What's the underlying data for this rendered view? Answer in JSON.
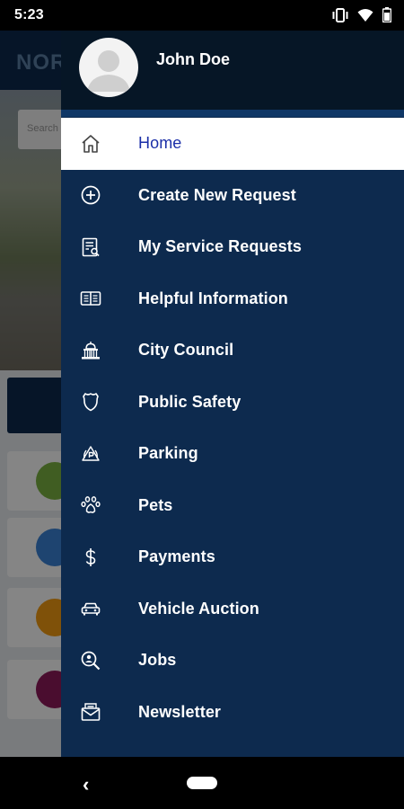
{
  "status_bar": {
    "time": "5:23",
    "icons": [
      "vibrate-icon",
      "wifi-icon",
      "battery-icon"
    ]
  },
  "background_app": {
    "logo_text": "NOR",
    "search_placeholder": "Search"
  },
  "drawer": {
    "user_name": "John Doe",
    "colors": {
      "header": "#061626",
      "body": "#0d2a4e",
      "active_text": "#1b2fa8"
    },
    "items": [
      {
        "label": "Home",
        "icon": "home-icon",
        "active": true
      },
      {
        "label": "Create New Request",
        "icon": "plus-circle-icon",
        "active": false
      },
      {
        "label": "My Service Requests",
        "icon": "document-search-icon",
        "active": false
      },
      {
        "label": "Helpful Information",
        "icon": "book-icon",
        "active": false
      },
      {
        "label": "City Council",
        "icon": "capitol-building-icon",
        "active": false
      },
      {
        "label": "Public Safety",
        "icon": "badge-shield-icon",
        "active": false
      },
      {
        "label": "Parking",
        "icon": "parking-icon",
        "active": false
      },
      {
        "label": "Pets",
        "icon": "paw-icon",
        "active": false
      },
      {
        "label": "Payments",
        "icon": "dollar-icon",
        "active": false
      },
      {
        "label": "Vehicle Auction",
        "icon": "car-icon",
        "active": false
      },
      {
        "label": "Jobs",
        "icon": "magnifier-person-icon",
        "active": false
      },
      {
        "label": "Newsletter",
        "icon": "envelope-icon",
        "active": false
      }
    ]
  },
  "nav_bar": {
    "back_glyph": "‹"
  }
}
